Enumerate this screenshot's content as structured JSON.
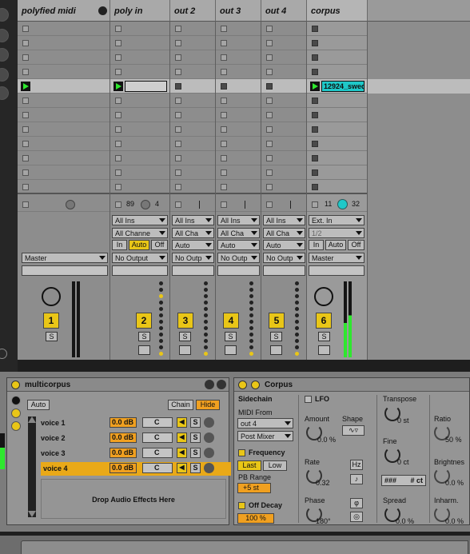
{
  "tracks": [
    {
      "name": "polyfied midi",
      "number": "",
      "input": "",
      "channel": "",
      "output": "Master",
      "clip": "",
      "solo": "S",
      "col_color": "#8d8d8d"
    },
    {
      "name": "poly in",
      "number": "2",
      "input": "All Ins",
      "channel": "All Channe",
      "output": "No Output",
      "clip": "",
      "solo": "S"
    },
    {
      "name": "out 2",
      "number": "3",
      "input": "All Ins",
      "channel": "All Cha",
      "output": "No Outp",
      "clip": "",
      "solo": "S"
    },
    {
      "name": "out 3",
      "number": "4",
      "input": "All Ins",
      "channel": "All Cha",
      "output": "No Outp",
      "clip": "",
      "solo": "S"
    },
    {
      "name": "out 4",
      "number": "5",
      "input": "All Ins",
      "channel": "All Cha",
      "output": "No Outp",
      "clip": "",
      "solo": "S"
    },
    {
      "name": "corpus",
      "number": "6",
      "input": "Ext. In",
      "channel": "1/2",
      "output": "Master",
      "clip": "12924_swed",
      "solo": "S"
    }
  ],
  "first_track_number": "1",
  "poly_in_values": {
    "a": "89",
    "b": "4"
  },
  "corpus_values": {
    "a": "11",
    "b": "32"
  },
  "monitor": {
    "in": "In",
    "auto": "Auto",
    "off": "Off"
  },
  "auto_label": "Auto",
  "rack": {
    "title": "multicorpus",
    "auto": "Auto",
    "chain": "Chain",
    "hide": "Hide",
    "voices": [
      {
        "name": "voice 1",
        "vol": "0.0 dB",
        "pan": "C",
        "solo": "S"
      },
      {
        "name": "voice 2",
        "vol": "0.0 dB",
        "pan": "C",
        "solo": "S"
      },
      {
        "name": "voice 3",
        "vol": "0.0 dB",
        "pan": "C",
        "solo": "S"
      },
      {
        "name": "voice 4",
        "vol": "0.0 dB",
        "pan": "C",
        "solo": "S"
      }
    ],
    "drop_text": "Drop Audio Effects Here"
  },
  "corpus": {
    "title": "Corpus",
    "sidechain": "Sidechain",
    "midi_from": "MIDI From",
    "midi_src": "out 4",
    "midi_tap": "Post Mixer",
    "frequency": "Frequency",
    "last": "Last",
    "low": "Low",
    "pb_range": "PB Range",
    "pb_value": "+5 st",
    "off_decay": "Off Decay",
    "off_decay_val": "100 %",
    "lfo": "LFO",
    "amount": "Amount",
    "amount_val": "0.0 %",
    "shape": "Shape",
    "rate": "Rate",
    "rate_val": "0.32",
    "hz": "Hz",
    "phase": "Phase",
    "phase_val": "180°",
    "transpose": "Transpose",
    "transpose_val": "0 st",
    "fine": "Fine",
    "fine_val": "0 ct",
    "note_hash": "###",
    "note_ct": "# ct",
    "spread": "Spread",
    "spread_val": "0.0 %",
    "ratio": "Ratio",
    "ratio_val": "50 %",
    "brightness": "Brightnes",
    "brightness_val": "0.0 %",
    "inharm": "Inharm.",
    "inharm_val": "0.0 %"
  },
  "colors": {
    "yellow": "#e9c617",
    "orange": "#f0a020",
    "green": "#2ee82e",
    "teal": "#1ec8c8"
  }
}
